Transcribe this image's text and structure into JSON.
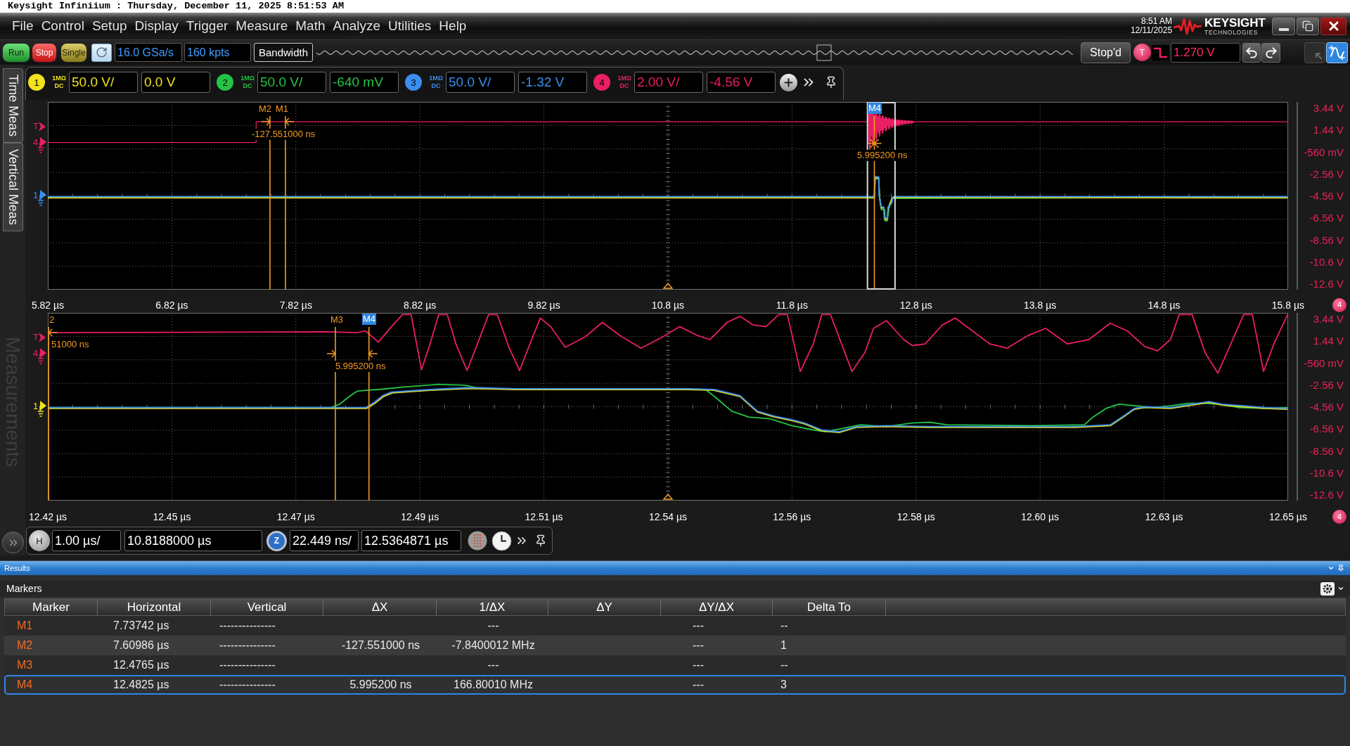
{
  "window": {
    "title": "Keysight Infiniium : Thursday, December 11, 2025 8:51:53 AM"
  },
  "menu": [
    "File",
    "Control",
    "Setup",
    "Display",
    "Trigger",
    "Measure",
    "Math",
    "Analyze",
    "Utilities",
    "Help"
  ],
  "clock": {
    "time": "8:51 AM",
    "date": "12/11/2025"
  },
  "logo": {
    "name": "KEYSIGHT",
    "tagline": "TECHNOLOGIES"
  },
  "toolbar": {
    "acquisition_buttons": [
      {
        "kind": "run",
        "label": "Run"
      },
      {
        "kind": "stop",
        "label": "Stop"
      },
      {
        "kind": "single",
        "label": "Single"
      }
    ],
    "sample_rate": "16.0 GSa/s",
    "memory_depth": "160 kpts",
    "bandwidth_button": "Bandwidth",
    "status_button": "Stop'd",
    "trigger_button": "T",
    "trigger_level": "1.270 V"
  },
  "side_tabs": [
    {
      "label": "Time Meas",
      "selected": false
    },
    {
      "label": "Vertical Meas",
      "selected": false
    }
  ],
  "side_panel_caption": "Measurements",
  "channels": [
    {
      "number": "1",
      "impedance": "1MΩ",
      "coupling": "DC",
      "scale": "50.0 V/",
      "offset": "0.0 V",
      "color": "#f0e21c"
    },
    {
      "number": "2",
      "impedance": "1MΩ",
      "coupling": "DC",
      "scale": "50.0 V/",
      "offset": "-640 mV",
      "color": "#23c445"
    },
    {
      "number": "3",
      "impedance": "1MΩ",
      "coupling": "DC",
      "scale": "50.0 V/",
      "offset": "-1.32 V",
      "color": "#3a8ef0"
    },
    {
      "number": "4",
      "impedance": "1MΩ",
      "coupling": "DC",
      "scale": "2.00 V/",
      "offset": "-4.56 V",
      "color": "#ea1e63"
    }
  ],
  "plots": [
    {
      "level_markers": [
        {
          "kind": "trigger",
          "label": "T",
          "color": "#ea1e63"
        },
        {
          "kind": "ground",
          "label": "4",
          "color": "#ea1e63"
        },
        {
          "kind": "ground",
          "label": "1",
          "color": "#3a8ef0"
        }
      ],
      "cursor_labels": [
        {
          "text": "M2",
          "selected": false
        },
        {
          "text": "M1",
          "selected": false
        },
        {
          "text": "M4",
          "selected": true
        }
      ],
      "delta_readouts": [
        "-127.551000 ns",
        "5.995200 ns"
      ],
      "y_labels": [
        "3.44 V",
        "1.44 V",
        "-560 mV",
        "-2.56 V",
        "-4.56 V",
        "-6.56 V",
        "-8.56 V",
        "-10.6 V",
        "-12.6 V"
      ],
      "x_labels": [
        "5.82 µs",
        "6.82 µs",
        "7.82 µs",
        "8.82 µs",
        "9.82 µs",
        "10.8 µs",
        "11.8 µs",
        "12.8 µs",
        "13.8 µs",
        "14.8 µs",
        "15.8 µs"
      ],
      "channel_badge": "4"
    },
    {
      "level_markers": [
        {
          "kind": "trigger",
          "label": "T",
          "color": "#ea1e63"
        },
        {
          "kind": "ground",
          "label": "4",
          "color": "#ea1e63"
        },
        {
          "kind": "ground",
          "label": "1",
          "color": "#f0e21c"
        }
      ],
      "cursor_labels": [
        {
          "text": "2",
          "selected": false
        },
        {
          "text": "M3",
          "selected": false
        },
        {
          "text": "M4",
          "selected": true
        }
      ],
      "delta_readouts": [
        "51000 ns",
        "5.995200 ns"
      ],
      "y_labels": [
        "3.44 V",
        "1.44 V",
        "-560 mV",
        "-2.56 V",
        "-4.56 V",
        "-6.56 V",
        "-8.56 V",
        "-10.6 V",
        "-12.6 V"
      ],
      "x_labels": [
        "12.42 µs",
        "12.45 µs",
        "12.47 µs",
        "12.49 µs",
        "12.51 µs",
        "12.54 µs",
        "12.56 µs",
        "12.58 µs",
        "12.60 µs",
        "12.63 µs",
        "12.65 µs"
      ],
      "channel_badge": "4"
    }
  ],
  "timebase": {
    "button": "H",
    "scale": "1.00 µs/",
    "position": "10.8188000 µs",
    "zoom_button": "Z",
    "zoom_scale": "22.449 ns/",
    "zoom_position": "12.5364871 µs"
  },
  "results": {
    "title": "Results",
    "section": "Markers",
    "columns": [
      "Marker",
      "Horizontal",
      "Vertical",
      "ΔX",
      "1/ΔX",
      "ΔY",
      "ΔY/ΔX",
      "Delta To"
    ],
    "rows": [
      {
        "cells": [
          "M1",
          "7.73742 µs",
          "---------------",
          null,
          "---",
          null,
          "---",
          "--"
        ],
        "selected": false
      },
      {
        "cells": [
          "M2",
          "7.60986 µs",
          "---------------",
          "-127.551000 ns",
          "-7.8400012 MHz",
          null,
          "---",
          "1"
        ],
        "selected": false
      },
      {
        "cells": [
          "M3",
          "12.4765 µs",
          "---------------",
          null,
          "---",
          null,
          "---",
          "--"
        ],
        "selected": false
      },
      {
        "cells": [
          "M4",
          "12.4825 µs",
          "---------------",
          "5.995200 ns",
          "166.80010 MHz",
          null,
          "---",
          "3"
        ],
        "selected": true
      }
    ]
  }
}
